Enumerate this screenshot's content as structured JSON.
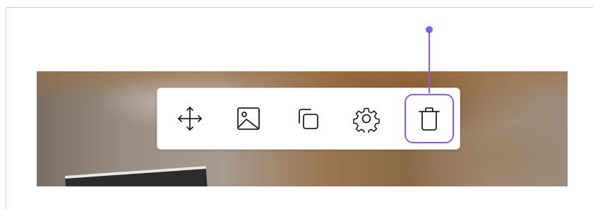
{
  "toolbar": {
    "tools": [
      {
        "name": "move",
        "icon": "move-icon"
      },
      {
        "name": "image",
        "icon": "image-icon"
      },
      {
        "name": "duplicate",
        "icon": "duplicate-icon"
      },
      {
        "name": "settings",
        "icon": "gear-icon"
      },
      {
        "name": "delete",
        "icon": "trash-icon"
      }
    ],
    "highlighted_tool": "delete"
  },
  "colors": {
    "accent": "#8a5cf0",
    "icon": "#1f1f1f",
    "toolbar_bg": "#ffffff"
  }
}
